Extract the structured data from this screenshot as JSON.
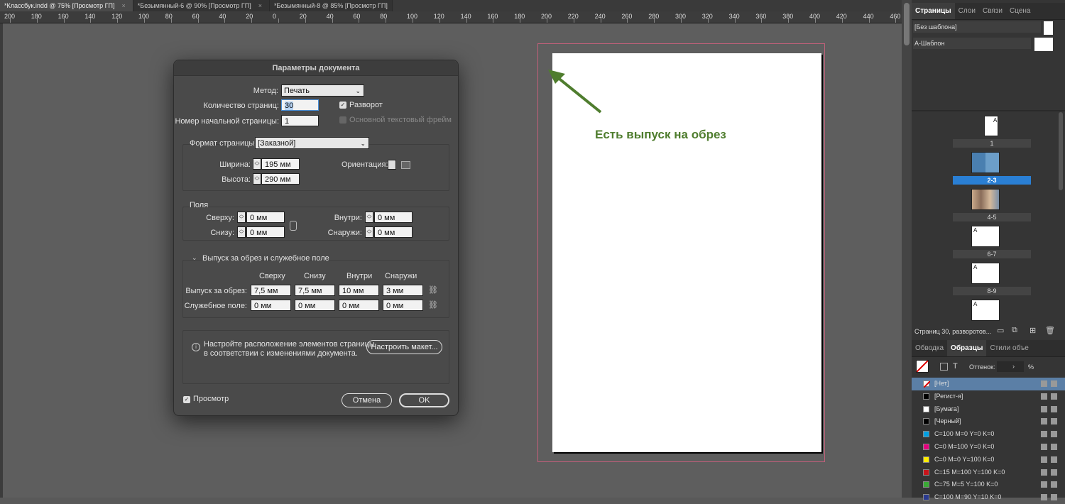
{
  "tabs": [
    {
      "label": "*Классбук.indd @ 75% [Просмотр ГП]"
    },
    {
      "label": "*Безымянный-6 @ 90% [Просмотр ГП]"
    },
    {
      "label": "*Безымянный-8 @ 85% [Просмотр ГП]"
    }
  ],
  "ruler_labels": [
    "200",
    "180",
    "160",
    "140",
    "120",
    "100",
    "80",
    "60",
    "40",
    "20",
    "0",
    "20",
    "40",
    "60",
    "80",
    "100",
    "120",
    "140",
    "160",
    "180",
    "200",
    "220",
    "240",
    "260",
    "280",
    "300",
    "320",
    "340",
    "360",
    "380",
    "400",
    "420",
    "440",
    "460"
  ],
  "annotation": "Есть выпуск на обрез",
  "dialog": {
    "title": "Параметры документа",
    "method_label": "Метод:",
    "method_value": "Печать",
    "pages_label": "Количество страниц:",
    "pages_value": "30",
    "spread_label": "Разворот",
    "start_label": "Номер начальной страницы:",
    "start_value": "1",
    "primary_frame_label": "Основной текстовый фрейм",
    "format_label": "Формат страницы:",
    "format_value": "[Заказной]",
    "width_label": "Ширина:",
    "width_value": "195 мм",
    "height_label": "Высота:",
    "height_value": "290 мм",
    "orientation_label": "Ориентация:",
    "margins_title": "Поля",
    "top_label": "Сверху:",
    "top_value": "0 мм",
    "bottom_label": "Снизу:",
    "bottom_value": "0 мм",
    "inside_label": "Внутри:",
    "inside_value": "0 мм",
    "outside_label": "Снаружи:",
    "outside_value": "0 мм",
    "bleed_title": "Выпуск за обрез и служебное поле",
    "col_top": "Сверху",
    "col_bottom": "Снизу",
    "col_inside": "Внутри",
    "col_outside": "Снаружи",
    "bleed_label": "Выпуск за обрез:",
    "bleed_values": [
      "7,5 мм",
      "7,5 мм",
      "10 мм",
      "3 мм"
    ],
    "slug_label": "Служебное поле:",
    "slug_values": [
      "0 мм",
      "0 мм",
      "0 мм",
      "0 мм"
    ],
    "info_text_1": "Настройте расположение элементов страницы",
    "info_text_2": "в соответствии с изменениями документа.",
    "adjust_button": "Настроить макет...",
    "preview_label": "Просмотр",
    "cancel_button": "Отмена",
    "ok_button": "OK"
  },
  "pages_panel": {
    "tabs": [
      "Страницы",
      "Слои",
      "Связи",
      "Сцена"
    ],
    "masters": [
      "[Без шаблона]",
      "А-Шаблон"
    ],
    "page_labels": [
      "1",
      "2-3",
      "4-5",
      "6-7",
      "8-9"
    ],
    "master_letter": "A",
    "status": "Страниц 30, разворотов..."
  },
  "swatches_panel": {
    "tabs": [
      "Обводка",
      "Образцы",
      "Стили объе"
    ],
    "tint_label": "Оттенок:",
    "tint_unit": "%",
    "text_icon": "T",
    "swatches": [
      {
        "name": "[Нет]",
        "color": "#ffffff"
      },
      {
        "name": "[Регист-я]",
        "color": "#000000"
      },
      {
        "name": "[Бумага]",
        "color": "#ffffff"
      },
      {
        "name": "[Черный]",
        "color": "#000000"
      },
      {
        "name": "C=100 M=0 Y=0 K=0",
        "color": "#00a0e3"
      },
      {
        "name": "C=0 M=100 Y=0 K=0",
        "color": "#e5007e"
      },
      {
        "name": "C=0 M=0 Y=100 K=0",
        "color": "#ffed00"
      },
      {
        "name": "C=15 M=100 Y=100 K=0",
        "color": "#c8151b"
      },
      {
        "name": "C=75 M=5 Y=100 K=0",
        "color": "#3aa935"
      },
      {
        "name": "C=100 M=90 Y=10 K=0",
        "color": "#2a3a8f"
      }
    ]
  }
}
